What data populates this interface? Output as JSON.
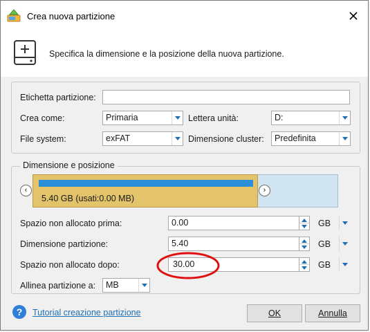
{
  "window": {
    "title": "Crea nuova partizione"
  },
  "header": {
    "description": "Specifica la dimensione e la posizione della nuova partizione."
  },
  "properties": {
    "partition_label_label": "Etichetta partizione:",
    "partition_label_value": "",
    "create_as_label": "Crea come:",
    "create_as_value": "Primaria",
    "drive_letter_label": "Lettera unità:",
    "drive_letter_value": "D:",
    "file_system_label": "File system:",
    "file_system_value": "exFAT",
    "cluster_size_label": "Dimensione cluster:",
    "cluster_size_value": "Predefinita"
  },
  "size_position": {
    "legend": "Dimensione e posizione",
    "bar_text": "5.40 GB (usati:0.00 MB)",
    "nav_prev": "‹",
    "nav_next": "›",
    "unalloc_before_label": "Spazio non allocato prima:",
    "unalloc_before_value": "0.00",
    "unalloc_before_unit": "GB",
    "partition_size_label": "Dimensione partizione:",
    "partition_size_value": "5.40",
    "partition_size_unit": "GB",
    "unalloc_after_label": "Spazio non allocato dopo:",
    "unalloc_after_value": "30.00",
    "unalloc_after_unit": "GB",
    "align_label": "Allinea partizione a:",
    "align_value": "MB"
  },
  "footer": {
    "tutorial_link": "Tutorial creazione partizione",
    "ok_label": "OK",
    "cancel_label": "Annulla"
  },
  "colors": {
    "accent": "#1f6fb5",
    "bar_used": "#e3c46a",
    "bar_free": "#d0e4f2",
    "annotation": "#e01010"
  },
  "icons": {
    "app": "partition-wizard-icon",
    "close": "close-icon",
    "drive": "drive-add-icon",
    "help": "help-icon"
  }
}
